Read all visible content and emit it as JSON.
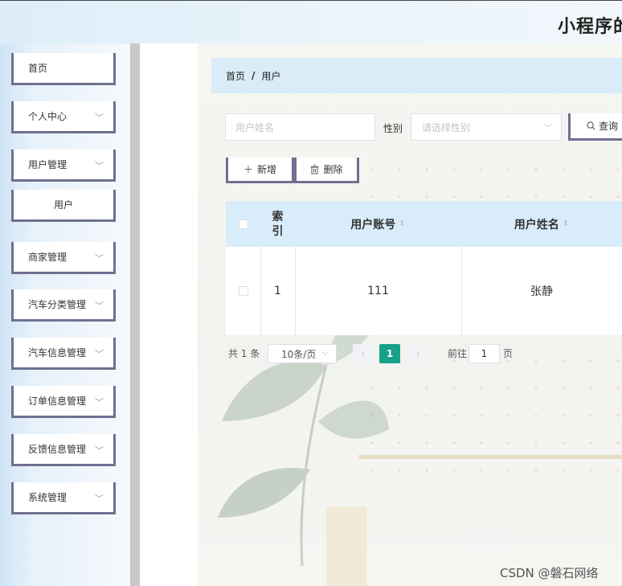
{
  "header": {
    "title": "小程序的"
  },
  "sidebar": {
    "items": [
      {
        "label": "首页",
        "has_arrow": false
      },
      {
        "label": "个人中心",
        "has_arrow": true
      },
      {
        "label": "用户管理",
        "has_arrow": true
      },
      {
        "label": "用户",
        "has_arrow": false
      },
      {
        "label": "商家管理",
        "has_arrow": true
      },
      {
        "label": "汽车分类管理",
        "has_arrow": true
      },
      {
        "label": "汽车信息管理",
        "has_arrow": true
      },
      {
        "label": "订单信息管理",
        "has_arrow": true
      },
      {
        "label": "反馈信息管理",
        "has_arrow": true
      },
      {
        "label": "系统管理",
        "has_arrow": true
      }
    ]
  },
  "breadcrumb": {
    "home": "首页",
    "separator": "/",
    "current": "用户"
  },
  "search": {
    "name_placeholder": "用户姓名",
    "gender_label": "性别",
    "gender_placeholder": "请选择性别",
    "query_label": "查询"
  },
  "actions": {
    "add_label": "新增",
    "delete_label": "删除"
  },
  "table": {
    "columns": [
      "索引",
      "用户账号",
      "用户姓名"
    ],
    "rows": [
      {
        "index": "1",
        "account": "111",
        "name": "张静"
      }
    ]
  },
  "pagination": {
    "total_label": "共 1 条",
    "page_size": "10条/页",
    "current_page": "1",
    "goto_label": "前往",
    "goto_value": "1",
    "page_suffix": "页"
  },
  "watermark": "CSDN @磐石网络",
  "colors": {
    "accent": "#16a08a",
    "header_bg": "#d8ecf9",
    "border_dark": "#6f7090"
  },
  "icons": {
    "dropdown": "chevron-down-icon",
    "search": "search-icon",
    "add": "plus-icon",
    "delete": "trash-icon"
  }
}
